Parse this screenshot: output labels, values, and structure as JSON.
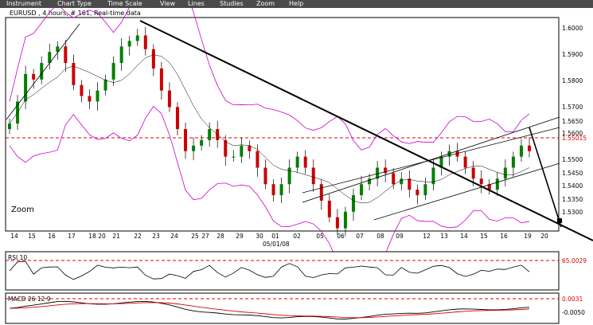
{
  "menu": [
    "Instrument",
    "Chart Type",
    "Time Scale",
    "View",
    "Lines",
    "Studies",
    "Zoom",
    "Help"
  ],
  "chart": {
    "symbol_label": "EURUSD , 4 hours, # 161, Real-time data",
    "zoom_label": "Zoom",
    "price_labels": [
      "1.6000",
      "1.5900",
      "1.5800",
      "1.5700",
      "1.5600",
      "1.5500",
      "1.5400",
      "1.5300",
      "1.5650",
      "1.5450",
      "1.5350"
    ],
    "current_price_label": "1.55015",
    "x_labels": [
      "14",
      "15",
      "16",
      "17",
      "18",
      "20",
      "21",
      "22",
      "23",
      "24",
      "25",
      "27",
      "28",
      "29",
      "30",
      "01",
      "02",
      "05",
      "06",
      "07",
      "08",
      "09",
      "12",
      "13",
      "14",
      "15",
      "16",
      "19",
      "20"
    ],
    "date_label": "05/01/08"
  },
  "rsi": {
    "label": "RSI 10",
    "level_label": "65.0029"
  },
  "macd": {
    "label": "MACD 26 12 9",
    "level_labels": [
      "0.0031",
      "-0.0050"
    ]
  },
  "colors": {
    "menubar": "#4a4a4a",
    "bands": "#cc00cc",
    "macd_signal": "#e00000",
    "dashed_level": "#e00000",
    "bull_candle": "#008000",
    "bear_candle": "#cc0000"
  },
  "chart_data": {
    "type": "candlestick",
    "instrument": "EURUSD",
    "timeframe": "4 hours",
    "close_series": [
      1.568,
      1.576,
      1.586,
      1.584,
      1.59,
      1.594,
      1.596,
      1.59,
      1.582,
      1.578,
      1.576,
      1.58,
      1.584,
      1.59,
      1.596,
      1.598,
      1.6,
      1.595,
      1.588,
      1.58,
      1.574,
      1.566,
      1.558,
      1.56,
      1.562,
      1.566,
      1.562,
      1.556,
      1.556,
      1.56,
      1.558,
      1.552,
      1.546,
      1.542,
      1.546,
      1.552,
      1.556,
      1.552,
      1.546,
      1.54,
      1.534,
      1.53,
      1.536,
      1.542,
      1.546,
      1.548,
      1.552,
      1.55,
      1.546,
      1.548,
      1.544,
      1.542,
      1.546,
      1.552,
      1.556,
      1.558,
      1.556,
      1.552,
      1.548,
      1.546,
      1.544,
      1.548,
      1.552,
      1.556,
      1.56,
      1.558
    ],
    "current_price": 1.55015,
    "y_range": [
      1.529,
      1.6065
    ],
    "rsi_period": 10,
    "rsi_level": 65.0029,
    "macd_params": [
      26,
      12,
      9
    ],
    "macd_levels": [
      0.0031,
      -0.005
    ],
    "indicators": [
      "Bollinger Bands",
      "RSI 10",
      "MACD 26 12 9"
    ]
  }
}
